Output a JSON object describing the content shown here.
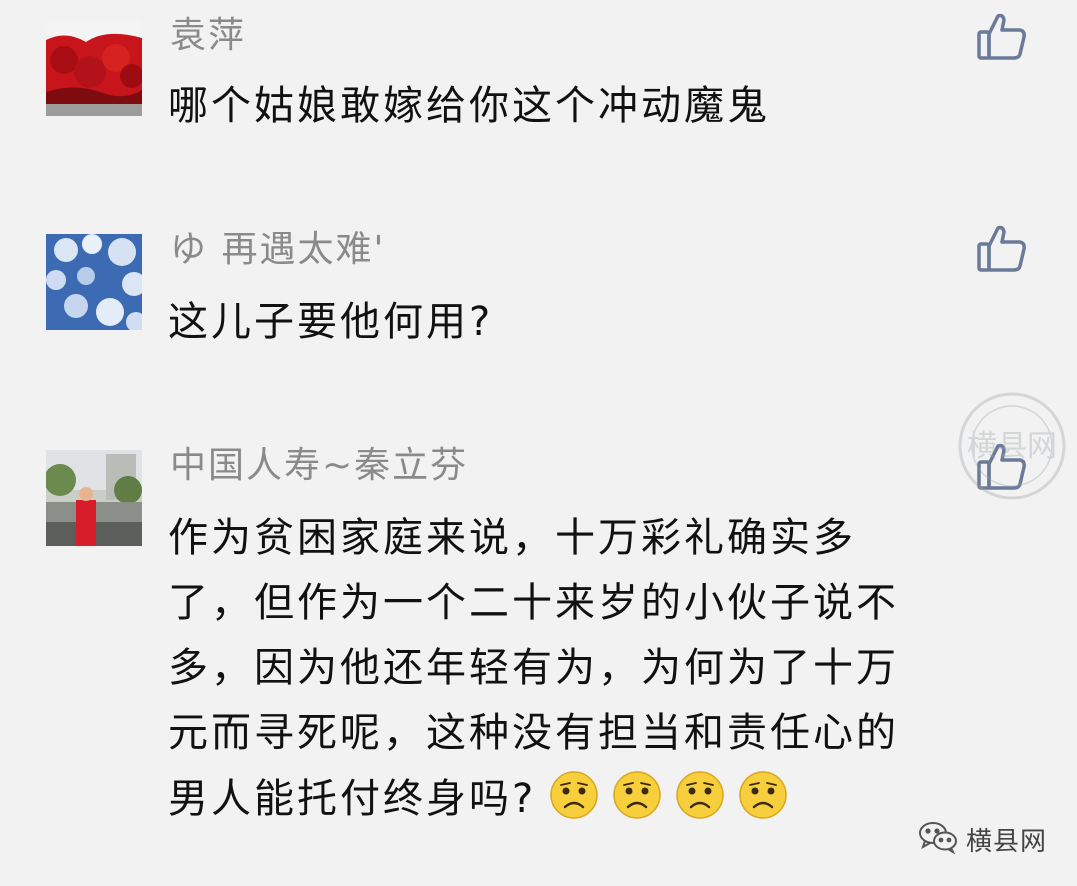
{
  "comments": [
    {
      "author": "袁萍",
      "lines": [
        "哪个姑娘敢嫁给你这个冲动魔鬼"
      ]
    },
    {
      "author": "ゆ 再遇太难'",
      "lines": [
        "这儿子要他何用?"
      ]
    },
    {
      "author": "中国人寿~秦立芬",
      "lines": [
        "作为贫困家庭来说，十万彩礼确实多",
        "了，但作为一个二十来岁的小伙子说不",
        "多，因为他还年轻有为，为何为了十万",
        "元而寻死呢，这种没有担当和责任心的",
        "男人能托付终身吗?"
      ],
      "emojis": [
        "frown-emoji",
        "frown-emoji",
        "frown-emoji",
        "frown-emoji"
      ]
    }
  ],
  "watermark": {
    "seal_text": "横县网",
    "brand_text": "横县网",
    "brand_icon": "wechat-icon"
  },
  "colors": {
    "background": "#f2f2f2",
    "author": "#8a8a8a",
    "text": "#111111",
    "like_icon": "#6b7a99"
  }
}
